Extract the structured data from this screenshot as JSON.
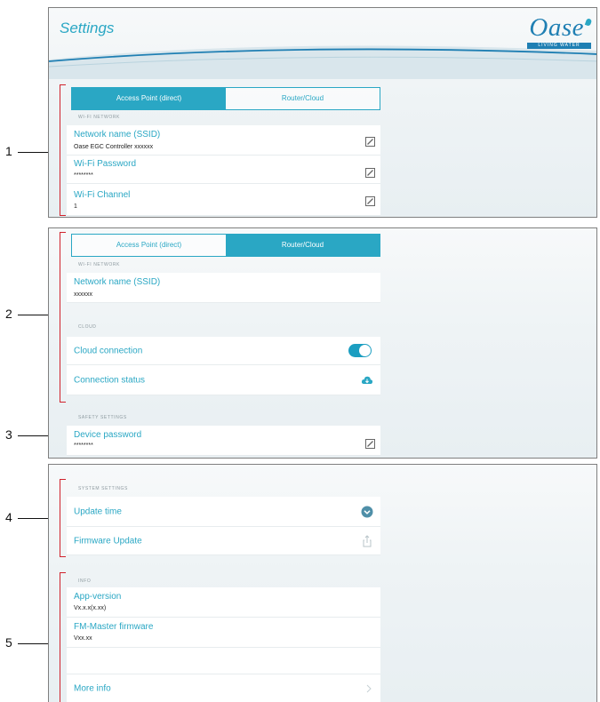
{
  "header": {
    "title": "Settings",
    "logo_text": "Oase",
    "logo_tagline": "LIVING WATER"
  },
  "callouts": [
    "1",
    "2",
    "3",
    "4",
    "5"
  ],
  "panel1": {
    "tabs": [
      "Access Point (direct)",
      "Router/Cloud"
    ],
    "active_tab": 0,
    "section_wifi": "WI-FI NETWORK",
    "rows": [
      {
        "label": "Network name (SSID)",
        "value": "Oase EGC Controller xxxxxx"
      },
      {
        "label": "Wi-Fi Password",
        "value": "********"
      },
      {
        "label": "Wi-Fi Channel",
        "value": "1"
      }
    ]
  },
  "panel2": {
    "tabs": [
      "Access Point (direct)",
      "Router/Cloud"
    ],
    "active_tab": 1,
    "section_wifi": "WI-FI NETWORK",
    "ssid_label": "Network name (SSID)",
    "ssid_value": "xxxxxx",
    "section_cloud": "CLOUD",
    "cloud_connection_label": "Cloud connection",
    "cloud_connection_on": true,
    "connection_status_label": "Connection status",
    "section_safety": "SAFETY SETTINGS",
    "device_password_label": "Device password",
    "device_password_value": "********"
  },
  "panel3": {
    "section_system": "SYSTEM SETTINGS",
    "update_time_label": "Update time",
    "firmware_update_label": "Firmware Update",
    "section_info": "INFO",
    "app_version_label": "App-version",
    "app_version_value": "Vx.x.x(x.xx)",
    "fm_master_label": "FM-Master firmware",
    "fm_master_value": "Vxx.xx",
    "more_info_label": "More info"
  },
  "colors": {
    "accent": "#2aa7c4",
    "bracket": "#d0222c",
    "logo": "#1f7fb3"
  }
}
